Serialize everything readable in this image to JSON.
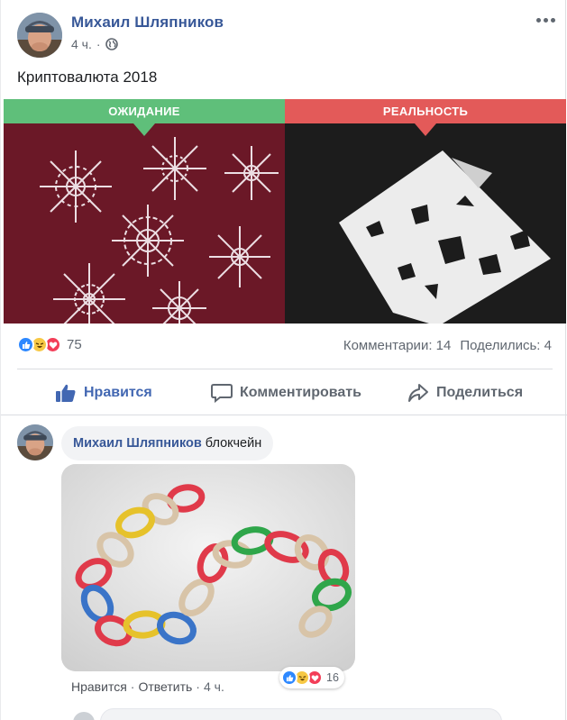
{
  "post": {
    "author": "Михаил Шляпников",
    "time": "4 ч.",
    "text": "Криптовалюта 2018",
    "meme": {
      "left_label": "ОЖИДАНИЕ",
      "right_label": "РЕАЛЬНОСТЬ",
      "left_color": "#5fbf7a",
      "right_color": "#e35a59"
    },
    "reaction_count": "75",
    "comments_label": "Комментарии: 14",
    "shares_label": "Поделились: 4",
    "actions": {
      "like": "Нравится",
      "comment": "Комментировать",
      "share": "Поделиться"
    },
    "icons": {
      "more": "more-dots-icon",
      "globe": "globe-icon",
      "like": "thumbs-up-icon",
      "comment": "speech-bubble-icon",
      "share": "share-arrow-icon"
    }
  },
  "comment": {
    "author": "Михаил Шляпников",
    "text": "блокчейн",
    "like_label": "Нравится",
    "reply_label": "Ответить",
    "time": "4 ч.",
    "reaction_count": "16"
  },
  "colors": {
    "link": "#385898",
    "accent": "#4267b2",
    "secondary_text": "#606770"
  }
}
